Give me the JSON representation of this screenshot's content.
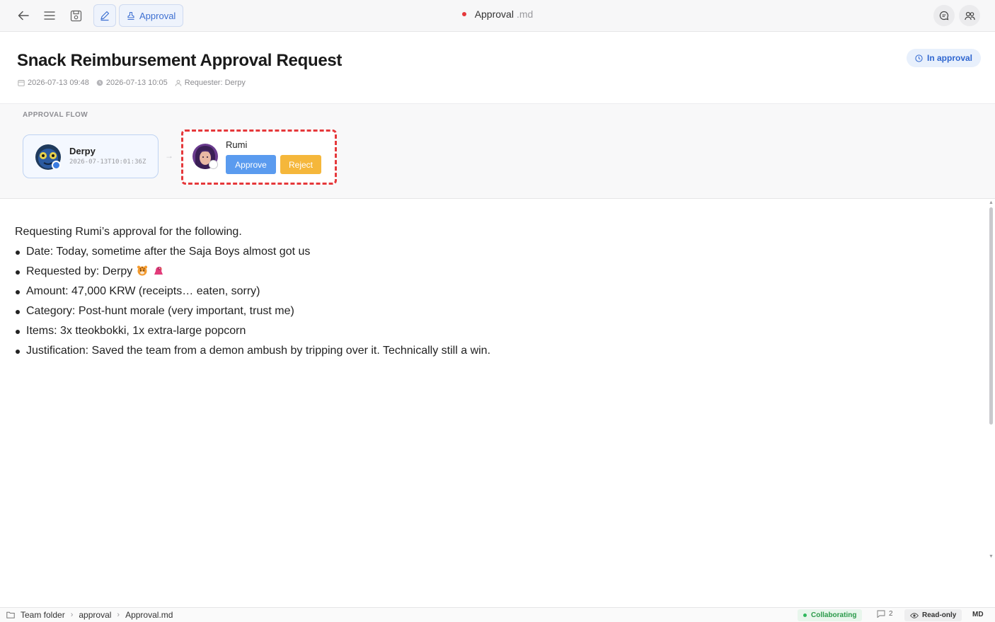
{
  "toolbar": {
    "approval_label": "Approval",
    "doc_name": "Approval",
    "doc_ext": ".md",
    "unsaved_indicator_color": "#e5383b"
  },
  "header": {
    "title": "Snack Reimbursement Approval Request",
    "created": "2026-07-13 09:48",
    "updated": "2026-07-13 10:05",
    "requester": "Requester: Derpy",
    "status": "In approval"
  },
  "flow": {
    "label": "APPROVAL FLOW",
    "steps": [
      {
        "name": "Derpy",
        "timestamp": "2026-07-13T10:01:36Z",
        "state": "approved"
      },
      {
        "name": "Rumi",
        "state": "pending",
        "approve_label": "Approve",
        "reject_label": "Reject"
      }
    ]
  },
  "content": {
    "intro": "Requesting Rumi’s approval for the following.",
    "items": [
      "Date: Today, sometime after the Saja Boys almost got us",
      "Requested by: Derpy",
      "Amount: 47,000 KRW (receipts… eaten, sorry)",
      "Category: Post-hunt morale (very important, trust me)",
      "Items: 3x tteokbokki, 1x extra-large popcorn",
      "Justification: Saved the team from a demon ambush by tripping over it. Technically still a win."
    ],
    "requested_by_emojis": [
      "tiger-emoji",
      "magpie-emoji"
    ]
  },
  "statusbar": {
    "breadcrumb": [
      "Team folder",
      "approval",
      "Approval.md"
    ],
    "collab": "Collaborating",
    "comment_count": "2",
    "readonly": "Read-only",
    "format": "MD"
  },
  "colors": {
    "accent": "#3d6fd1",
    "approve": "#5a9bef",
    "reject": "#f5b73b",
    "highlight": "#e5383b",
    "collab_green": "#2a9a4a"
  }
}
